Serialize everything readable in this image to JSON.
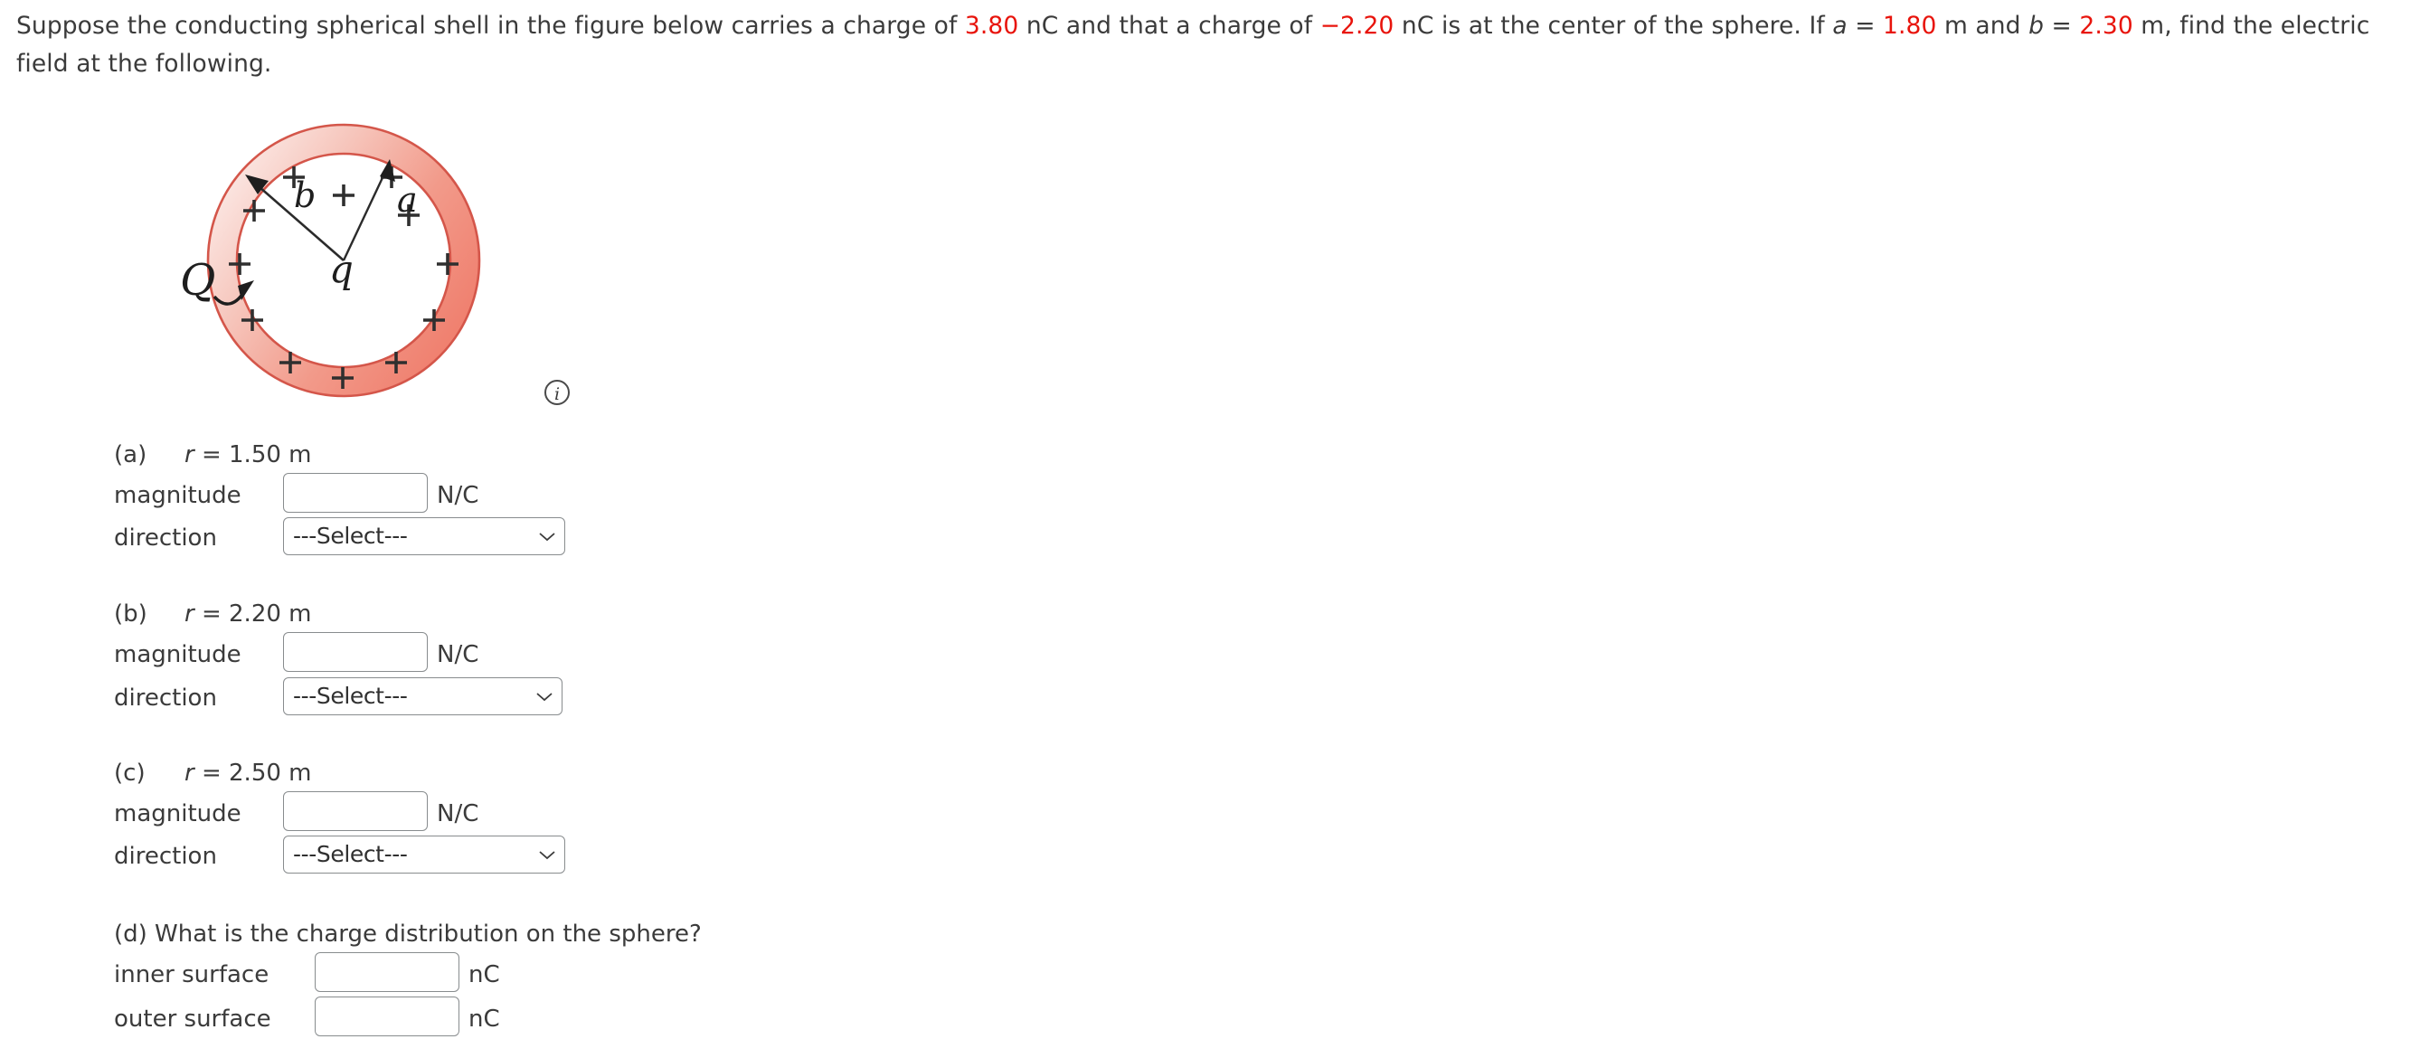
{
  "statement": {
    "part1": "Suppose the conducting spherical shell in the figure below carries a charge of ",
    "charge_shell": "3.80",
    "part2": " nC and that a charge of ",
    "charge_center": "−2.20",
    "part3": " nC is at the center of the sphere. If ",
    "var_a": "a",
    "eq1": " = ",
    "value_a": "1.80",
    "part4": " m and ",
    "var_b": "b",
    "eq2": " = ",
    "value_b": "2.30",
    "part5": " m, find the electric field at the following."
  },
  "figure": {
    "label_outer_radius": "b",
    "label_inner_radius": "a",
    "label_center_charge": "q",
    "label_shell_charge": "Q",
    "plus_sign": "+",
    "colors": {
      "shell_dark": "#f0806f",
      "shell_light": "#fdf3f1",
      "outline": "#d15a4e",
      "plus": "#2d2d2d"
    },
    "info_icon_letter": "i"
  },
  "questions": [
    {
      "label": "(a)",
      "condition_var": "r",
      "condition_eq": " = 1.50 m",
      "magnitude_label": "magnitude",
      "magnitude_value": "",
      "magnitude_unit": "N/C",
      "direction_label": "direction",
      "direction_value": "---Select---"
    },
    {
      "label": "(b)",
      "condition_var": "r",
      "condition_eq": " = 2.20 m",
      "magnitude_label": "magnitude",
      "magnitude_value": "",
      "magnitude_unit": "N/C",
      "direction_label": "direction",
      "direction_value": "---Select---"
    },
    {
      "label": "(c)",
      "condition_var": "r",
      "condition_eq": " = 2.50 m",
      "magnitude_label": "magnitude",
      "magnitude_value": "",
      "magnitude_unit": "N/C",
      "direction_label": "direction",
      "direction_value": "---Select---"
    }
  ],
  "part_d": {
    "label": "(d) What is the charge distribution on the sphere?",
    "inner_label": "inner surface",
    "inner_value": "",
    "inner_unit": "nC",
    "outer_label": "outer surface",
    "outer_value": "",
    "outer_unit": "nC"
  }
}
